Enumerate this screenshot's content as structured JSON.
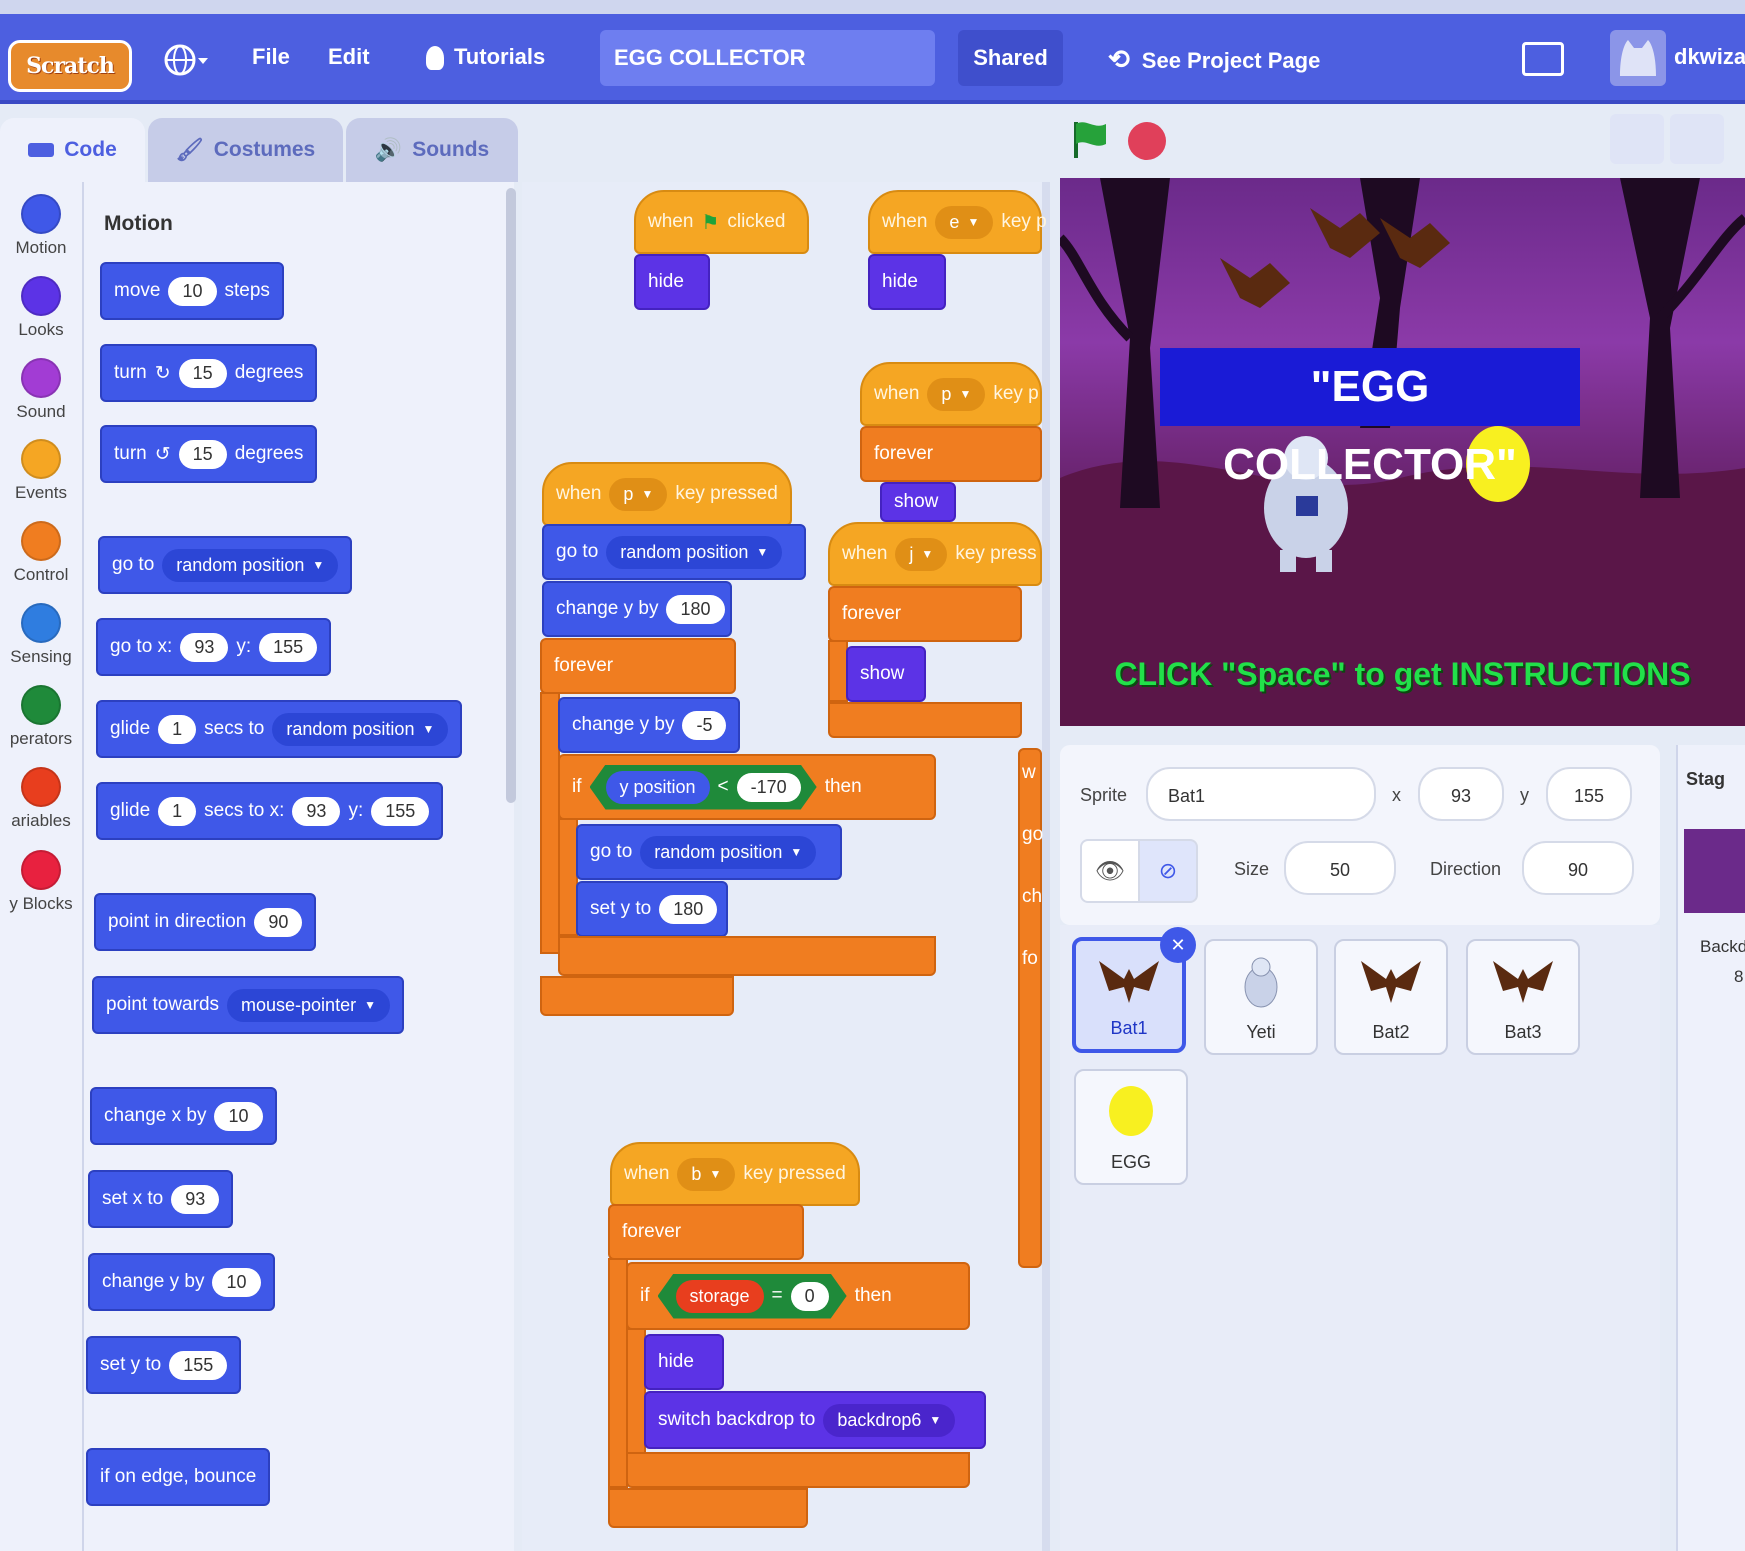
{
  "menubar": {
    "logo": "Scratch",
    "file": "File",
    "edit": "Edit",
    "tutorials": "Tutorials",
    "project_title": "EGG COLLECTOR",
    "shared": "Shared",
    "see_project_page": "See Project Page",
    "username": "dkwiza"
  },
  "tabs": {
    "code": "Code",
    "costumes": "Costumes",
    "sounds": "Sounds"
  },
  "categories": [
    {
      "label": "Motion",
      "color": "#3f58e8"
    },
    {
      "label": "Looks",
      "color": "#5c33e6"
    },
    {
      "label": "Sound",
      "color": "#a23cd4"
    },
    {
      "label": "Events",
      "color": "#f5a623"
    },
    {
      "label": "Control",
      "color": "#f07d20"
    },
    {
      "label": "Sensing",
      "color": "#2f7de0"
    },
    {
      "label": "perators",
      "color": "#1f8a3a"
    },
    {
      "label": "ariables",
      "color": "#e83e1e"
    },
    {
      "label": "y Blocks",
      "color": "#e8213f"
    }
  ],
  "palette": {
    "heading": "Motion",
    "move": {
      "a": "move",
      "n": "10",
      "b": "steps"
    },
    "turn_cw": {
      "a": "turn",
      "icon": "↻",
      "n": "15",
      "b": "degrees"
    },
    "turn_ccw": {
      "a": "turn",
      "icon": "↺",
      "n": "15",
      "b": "degrees"
    },
    "goto": {
      "a": "go to",
      "dd": "random position"
    },
    "goto_xy": {
      "a": "go to x:",
      "x": "93",
      "b": "y:",
      "y": "155"
    },
    "glide": {
      "a": "glide",
      "n": "1",
      "b": "secs to",
      "dd": "random position"
    },
    "glide_xy": {
      "a": "glide",
      "n": "1",
      "b": "secs to x:",
      "x": "93",
      "c": "y:",
      "y": "155"
    },
    "point_dir": {
      "a": "point in direction",
      "n": "90"
    },
    "point_towards": {
      "a": "point towards",
      "dd": "mouse-pointer"
    },
    "change_x": {
      "a": "change x by",
      "n": "10"
    },
    "set_x": {
      "a": "set x to",
      "n": "93"
    },
    "change_y": {
      "a": "change y by",
      "n": "10"
    },
    "set_y": {
      "a": "set y to",
      "n": "155"
    },
    "bounce": "if on edge, bounce"
  },
  "code": {
    "s1_hat": {
      "a": "when",
      "b": "clicked"
    },
    "s1_hide": "hide",
    "s2_hat": {
      "a": "when",
      "key": "e",
      "b": "key p"
    },
    "s2_hide": "hide",
    "s3_hat": {
      "a": "when",
      "key": "p",
      "b": "key p"
    },
    "s3_forever": "forever",
    "s3_show": "show",
    "s4_hat": {
      "a": "when",
      "key": "p",
      "b": "key pressed"
    },
    "s4_goto": {
      "a": "go to",
      "dd": "random position"
    },
    "s4_change": {
      "a": "change y by",
      "n": "180"
    },
    "s4_forever": "forever",
    "s4_change2": {
      "a": "change y by",
      "n": "-5"
    },
    "s4_if": {
      "a": "if",
      "rep": "y position",
      "op": "<",
      "n": "-170",
      "b": "then"
    },
    "s4_goto2": {
      "a": "go to",
      "dd": "random position"
    },
    "s4_sety": {
      "a": "set y to",
      "n": "180"
    },
    "s5_hat": {
      "a": "when",
      "key": "j",
      "b": "key press"
    },
    "s5_forever": "forever",
    "s5_show": "show",
    "s6_hat": {
      "a": "when",
      "key": "b",
      "b": "key pressed"
    },
    "s6_forever": "forever",
    "s6_if": {
      "a": "if",
      "var": "storage",
      "op": "=",
      "n": "0",
      "b": "then"
    },
    "s6_hide": "hide",
    "s6_switch": {
      "a": "switch backdrop to",
      "dd": "backdrop6"
    },
    "partial": {
      "w": "w",
      "go": "go",
      "ch": "ch",
      "fo": "fo"
    }
  },
  "stage": {
    "title": "\"EGG COLLECTOR\"",
    "instructions": "CLICK \"Space\" to get INSTRUCTIONS"
  },
  "sprite_info": {
    "sprite_label": "Sprite",
    "sprite_name": "Bat1",
    "x_label": "x",
    "x": "93",
    "y_label": "y",
    "y": "155",
    "size_label": "Size",
    "size": "50",
    "direction_label": "Direction",
    "direction": "90"
  },
  "sprites": [
    {
      "name": "Bat1",
      "selected": true
    },
    {
      "name": "Yeti",
      "selected": false
    },
    {
      "name": "Bat2",
      "selected": false
    },
    {
      "name": "Bat3",
      "selected": false
    },
    {
      "name": "EGG",
      "selected": false
    }
  ],
  "stage_panel": {
    "label": "Stag",
    "backdrops_label": "Backd",
    "count": "8"
  }
}
